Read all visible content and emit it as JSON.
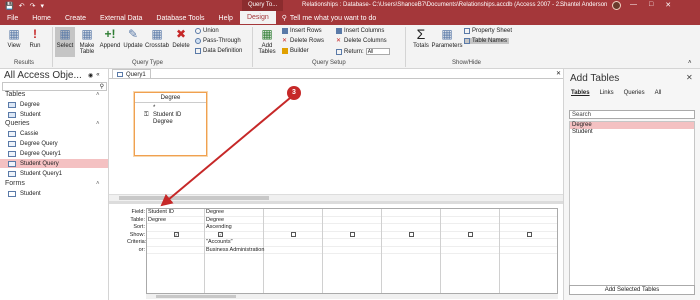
{
  "titlebar": {
    "tools_tab": "Query To...",
    "title": "Relationships : Database- C:\\Users\\ShanceB7\\Documents\\Relationships.accdb (Access 2007 - 2...",
    "user": "Shantel Anderson"
  },
  "ribbon_tabs": [
    "File",
    "Home",
    "Create",
    "External Data",
    "Database Tools",
    "Help",
    "Design"
  ],
  "tell_me": "Tell me what you want to do",
  "ribbon": {
    "view": "View",
    "run": "Run",
    "select": "Select",
    "make_table": "Make Table",
    "append": "Append",
    "update": "Update",
    "crosstab": "Crosstab",
    "delete": "Delete",
    "union": "Union",
    "pass_through": "Pass-Through",
    "data_definition": "Data Definition",
    "add_tables": "Add Tables",
    "insert_rows": "Insert Rows",
    "delete_rows": "Delete Rows",
    "builder": "Builder",
    "insert_columns": "Insert Columns",
    "delete_columns": "Delete Columns",
    "return_label": "Return:",
    "return_value": "All",
    "totals": "Totals",
    "parameters": "Parameters",
    "property_sheet": "Property Sheet",
    "table_names": "Table Names",
    "group_results": "Results",
    "group_query_type": "Query Type",
    "group_query_setup": "Query Setup",
    "group_show_hide": "Show/Hide"
  },
  "nav": {
    "title": "All Access Obje...",
    "tables_header": "Tables",
    "tables": [
      "Degree",
      "Student"
    ],
    "queries_header": "Queries",
    "queries": [
      "Cassie",
      "Degree Query",
      "Degree Query1",
      "Student Query",
      "Student Query1"
    ],
    "selected_query": "Student Query",
    "forms_header": "Forms",
    "forms": [
      "Student"
    ]
  },
  "document": {
    "tab_label": "Query1",
    "table_box": {
      "title": "Degree",
      "fields": [
        "*",
        "Student ID",
        "Degree"
      ]
    },
    "grid": {
      "row_labels": [
        "Field:",
        "Table:",
        "Sort:",
        "Show:",
        "Criteria:",
        "or:"
      ],
      "columns": [
        {
          "field": "Student ID",
          "table": "Degree",
          "sort": "",
          "show": true,
          "criteria": "",
          "or": ""
        },
        {
          "field": "Degree",
          "table": "Degree",
          "sort": "Ascending",
          "show": true,
          "criteria": "\"Accounts\"",
          "or": "Business Administration"
        },
        {
          "field": "",
          "table": "",
          "sort": "",
          "show": false,
          "criteria": "",
          "or": ""
        },
        {
          "field": "",
          "table": "",
          "sort": "",
          "show": false,
          "criteria": "",
          "or": ""
        },
        {
          "field": "",
          "table": "",
          "sort": "",
          "show": false,
          "criteria": "",
          "or": ""
        },
        {
          "field": "",
          "table": "",
          "sort": "",
          "show": false,
          "criteria": "",
          "or": ""
        },
        {
          "field": "",
          "table": "",
          "sort": "",
          "show": false,
          "criteria": "",
          "or": ""
        }
      ]
    }
  },
  "annotation": {
    "marker": "3",
    "color": "#c62828"
  },
  "add_tables_pane": {
    "title": "Add Tables",
    "tabs": [
      "Tables",
      "Links",
      "Queries",
      "All"
    ],
    "active_tab": "Tables",
    "search_placeholder": "Search",
    "items": [
      "Degree",
      "Student"
    ],
    "selected_item": "Degree",
    "add_button": "Add Selected Tables"
  },
  "colors": {
    "accent": "#a4373a",
    "selection": "#f4c1c2",
    "arrow": "#c62828"
  }
}
